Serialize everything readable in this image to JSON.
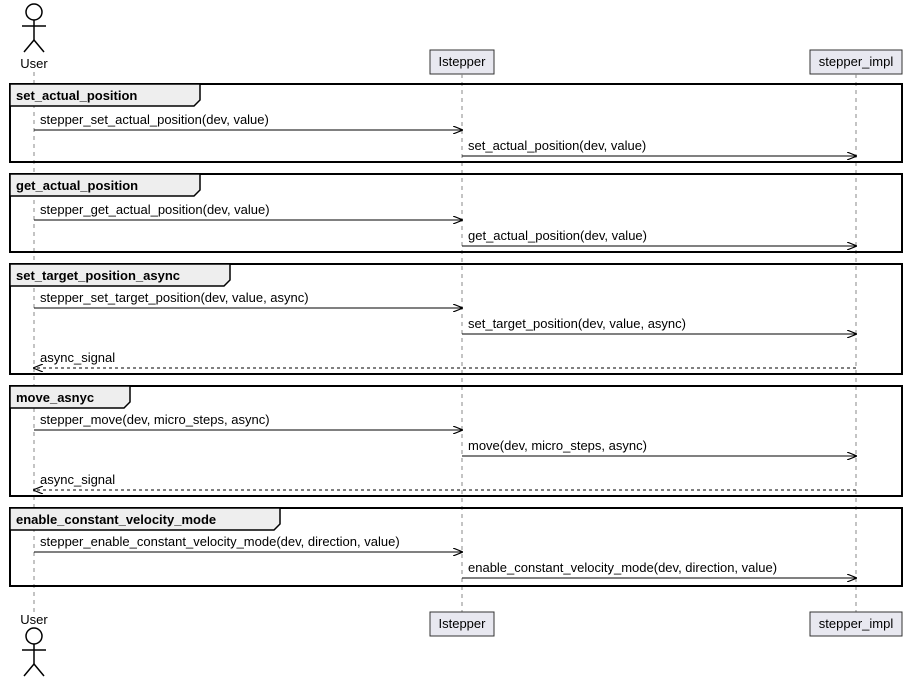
{
  "participants": {
    "user": "User",
    "istepper": "Istepper",
    "stepper_impl": "stepper_impl"
  },
  "frames": [
    {
      "title": "set_actual_position",
      "messages": [
        {
          "from": "user",
          "to": "istepper",
          "text": "stepper_set_actual_position(dev, value)",
          "type": "solid"
        },
        {
          "from": "istepper",
          "to": "stepper_impl",
          "text": "set_actual_position(dev, value)",
          "type": "solid"
        }
      ]
    },
    {
      "title": "get_actual_position",
      "messages": [
        {
          "from": "user",
          "to": "istepper",
          "text": "stepper_get_actual_position(dev, value)",
          "type": "solid"
        },
        {
          "from": "istepper",
          "to": "stepper_impl",
          "text": "get_actual_position(dev, value)",
          "type": "solid"
        }
      ]
    },
    {
      "title": "set_target_position_async",
      "messages": [
        {
          "from": "user",
          "to": "istepper",
          "text": "stepper_set_target_position(dev, value, async)",
          "type": "solid"
        },
        {
          "from": "istepper",
          "to": "stepper_impl",
          "text": "set_target_position(dev, value, async)",
          "type": "solid"
        },
        {
          "from": "stepper_impl",
          "to": "user",
          "text": "async_signal",
          "type": "dash"
        }
      ]
    },
    {
      "title": "move_asnyc",
      "messages": [
        {
          "from": "user",
          "to": "istepper",
          "text": "stepper_move(dev, micro_steps, async)",
          "type": "solid"
        },
        {
          "from": "istepper",
          "to": "stepper_impl",
          "text": "move(dev, micro_steps, async)",
          "type": "solid"
        },
        {
          "from": "stepper_impl",
          "to": "user",
          "text": "async_signal",
          "type": "dash"
        }
      ]
    },
    {
      "title": "enable_constant_velocity_mode",
      "messages": [
        {
          "from": "user",
          "to": "istepper",
          "text": "stepper_enable_constant_velocity_mode(dev, direction, value)",
          "type": "solid"
        },
        {
          "from": "istepper",
          "to": "stepper_impl",
          "text": "enable_constant_velocity_mode(dev, direction, value)",
          "type": "solid"
        }
      ]
    }
  ]
}
